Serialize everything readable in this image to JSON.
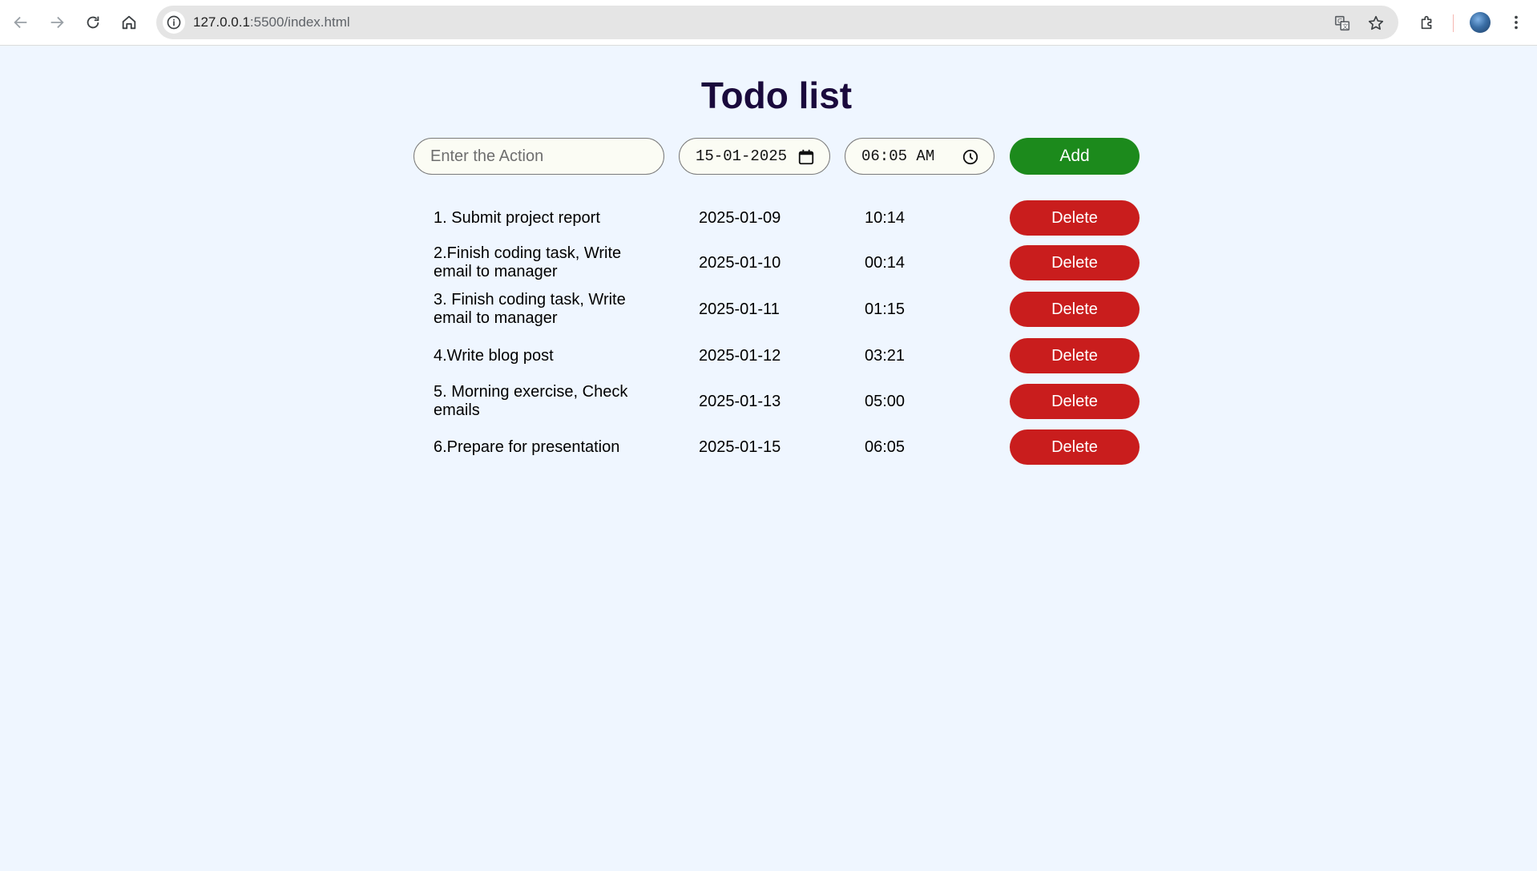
{
  "browser": {
    "url_host": "127.0.0.1",
    "url_rest": ":5500/index.html"
  },
  "page": {
    "title": "Todo list"
  },
  "form": {
    "task_placeholder": "Enter the Action",
    "date_value": "15-01-2025",
    "time_value": "06:05 AM",
    "add_label": "Add"
  },
  "todos": [
    {
      "task": "1. Submit project report",
      "date": "2025-01-09",
      "time": "10:14",
      "delete_label": "Delete"
    },
    {
      "task": "2.Finish coding task, Write email to manager",
      "date": "2025-01-10",
      "time": "00:14",
      "delete_label": "Delete"
    },
    {
      "task": "3. Finish coding task, Write email to manager",
      "date": "2025-01-11",
      "time": "01:15",
      "delete_label": "Delete"
    },
    {
      "task": "4.Write blog post",
      "date": "2025-01-12",
      "time": "03:21",
      "delete_label": "Delete"
    },
    {
      "task": "5. Morning exercise, Check emails",
      "date": "2025-01-13",
      "time": "05:00",
      "delete_label": "Delete"
    },
    {
      "task": "6.Prepare for presentation",
      "date": "2025-01-15",
      "time": "06:05",
      "delete_label": "Delete"
    }
  ],
  "colors": {
    "background": "#eff6ff",
    "add_button": "#1c8a1c",
    "delete_button": "#c91d1d",
    "title": "#1a0a3c"
  },
  "icons": {
    "back": "back-arrow-icon",
    "forward": "forward-arrow-icon",
    "reload": "reload-icon",
    "home": "home-icon",
    "site_info": "info-icon",
    "translate": "translate-icon",
    "bookmark": "star-icon",
    "extensions": "puzzle-icon",
    "menu": "kebab-menu-icon",
    "calendar": "calendar-icon",
    "clock": "clock-icon"
  }
}
